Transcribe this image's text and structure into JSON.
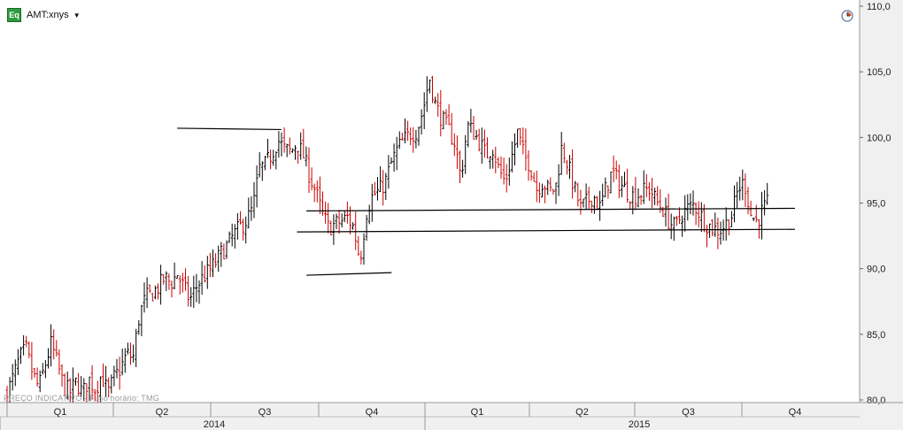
{
  "header": {
    "badge": "Eq",
    "symbol": "AMT:xnys",
    "dropdown_glyph": "▼",
    "clock_icon": "clock-icon"
  },
  "watermark": {
    "text": "PREÇO INDICATIVO - Fuso horário: TMG"
  },
  "colors": {
    "up": "#000000",
    "down": "#cc0000",
    "trendline": "#000000",
    "axis_bg": "#f0f0f0",
    "grid": "#c8c8c8"
  },
  "chart_data": {
    "type": "ohlc",
    "y_axis": {
      "ticks": [
        "110,0",
        "105,0",
        "100,0",
        "95,0",
        "90,0",
        "85,0",
        "80,0"
      ],
      "range": [
        79.8,
        110.2
      ],
      "position": "right"
    },
    "x_axis": {
      "quarters": [
        "Q1",
        "Q2",
        "Q3",
        "Q4",
        "Q1",
        "Q2",
        "Q3",
        "Q4"
      ],
      "years": [
        "2014",
        "2015"
      ]
    },
    "trendlines": [
      {
        "name": "upper-short",
        "from": {
          "period": 0.54,
          "price": 100.7
        },
        "to": {
          "period": 0.87,
          "price": 100.6
        }
      },
      {
        "name": "lower-short",
        "from": {
          "period": 0.95,
          "price": 89.5
        },
        "to": {
          "period": 1.22,
          "price": 89.7
        }
      },
      {
        "name": "resistance",
        "from": {
          "period": 0.95,
          "price": 94.4
        },
        "to": {
          "period": 2.5,
          "price": 94.6
        }
      },
      {
        "name": "support",
        "from": {
          "period": 0.92,
          "price": 92.8
        },
        "to": {
          "period": 2.5,
          "price": 93.0
        }
      }
    ],
    "anchors": [
      [
        0.0,
        80.5
      ],
      [
        0.02,
        81.8
      ],
      [
        0.04,
        83.2
      ],
      [
        0.06,
        83.9
      ],
      [
        0.08,
        82.1
      ],
      [
        0.1,
        80.9
      ],
      [
        0.12,
        82.6
      ],
      [
        0.14,
        84.3
      ],
      [
        0.16,
        82.7
      ],
      [
        0.18,
        81.0
      ],
      [
        0.2,
        80.6
      ],
      [
        0.22,
        81.4
      ],
      [
        0.24,
        80.5
      ],
      [
        0.26,
        81.6
      ],
      [
        0.28,
        80.8
      ],
      [
        0.3,
        81.9
      ],
      [
        0.32,
        80.5
      ],
      [
        0.34,
        81.7
      ],
      [
        0.36,
        82.4
      ],
      [
        0.38,
        83.5
      ],
      [
        0.4,
        83.2
      ],
      [
        0.42,
        86.5
      ],
      [
        0.44,
        87.8
      ],
      [
        0.46,
        88.1
      ],
      [
        0.48,
        88.6
      ],
      [
        0.5,
        89.3
      ],
      [
        0.52,
        88.9
      ],
      [
        0.54,
        89.6
      ],
      [
        0.56,
        88.6
      ],
      [
        0.58,
        87.6
      ],
      [
        0.6,
        88.6
      ],
      [
        0.62,
        89.3
      ],
      [
        0.64,
        89.8
      ],
      [
        0.66,
        90.4
      ],
      [
        0.68,
        91.2
      ],
      [
        0.7,
        91.8
      ],
      [
        0.72,
        92.6
      ],
      [
        0.74,
        93.2
      ],
      [
        0.76,
        93.7
      ],
      [
        0.78,
        94.6
      ],
      [
        0.8,
        97.6
      ],
      [
        0.82,
        97.9
      ],
      [
        0.84,
        98.8
      ],
      [
        0.86,
        99.8
      ],
      [
        0.88,
        99.1
      ],
      [
        0.9,
        98.9
      ],
      [
        0.92,
        99.6
      ],
      [
        0.94,
        98.6
      ],
      [
        0.96,
        97.1
      ],
      [
        0.98,
        95.8
      ],
      [
        1.0,
        94.2
      ],
      [
        1.02,
        93.1
      ],
      [
        1.04,
        93.4
      ],
      [
        1.06,
        93.6
      ],
      [
        1.08,
        93.9
      ],
      [
        1.1,
        93.1
      ],
      [
        1.12,
        90.6
      ],
      [
        1.14,
        94.3
      ],
      [
        1.16,
        95.6
      ],
      [
        1.18,
        95.9
      ],
      [
        1.2,
        96.6
      ],
      [
        1.22,
        98.1
      ],
      [
        1.24,
        99.2
      ],
      [
        1.26,
        99.8
      ],
      [
        1.28,
        100.3
      ],
      [
        1.3,
        100.5
      ],
      [
        1.32,
        102.1
      ],
      [
        1.34,
        104.6
      ],
      [
        1.36,
        102.4
      ],
      [
        1.38,
        101.4
      ],
      [
        1.4,
        100.6
      ],
      [
        1.42,
        99.6
      ],
      [
        1.44,
        96.9
      ],
      [
        1.46,
        100.9
      ],
      [
        1.48,
        100.4
      ],
      [
        1.5,
        99.6
      ],
      [
        1.52,
        98.6
      ],
      [
        1.54,
        99.3
      ],
      [
        1.56,
        97.6
      ],
      [
        1.58,
        96.6
      ],
      [
        1.6,
        98.4
      ],
      [
        1.62,
        100.4
      ],
      [
        1.64,
        98.6
      ],
      [
        1.66,
        97.9
      ],
      [
        1.68,
        96.1
      ],
      [
        1.7,
        96.6
      ],
      [
        1.72,
        95.9
      ],
      [
        1.74,
        96.1
      ],
      [
        1.76,
        99.3
      ],
      [
        1.78,
        97.9
      ],
      [
        1.8,
        96.1
      ],
      [
        1.82,
        94.6
      ],
      [
        1.84,
        95.1
      ],
      [
        1.86,
        95.6
      ],
      [
        1.88,
        94.6
      ],
      [
        1.9,
        96.1
      ],
      [
        1.92,
        97.4
      ],
      [
        1.94,
        96.6
      ],
      [
        1.96,
        96.1
      ],
      [
        1.98,
        95.6
      ],
      [
        2.0,
        95.6
      ],
      [
        2.02,
        95.9
      ],
      [
        2.04,
        96.1
      ],
      [
        2.06,
        95.1
      ],
      [
        2.08,
        94.6
      ],
      [
        2.1,
        93.6
      ],
      [
        2.12,
        93.1
      ],
      [
        2.14,
        94.1
      ],
      [
        2.16,
        94.6
      ],
      [
        2.18,
        94.9
      ],
      [
        2.2,
        94.1
      ],
      [
        2.22,
        93.4
      ],
      [
        2.24,
        93.1
      ],
      [
        2.26,
        92.9
      ],
      [
        2.28,
        93.4
      ],
      [
        2.3,
        94.1
      ],
      [
        2.32,
        96.1
      ],
      [
        2.34,
        96.6
      ],
      [
        2.36,
        94.1
      ],
      [
        2.38,
        93.6
      ],
      [
        2.4,
        94.6
      ],
      [
        2.42,
        95.1
      ]
    ]
  }
}
